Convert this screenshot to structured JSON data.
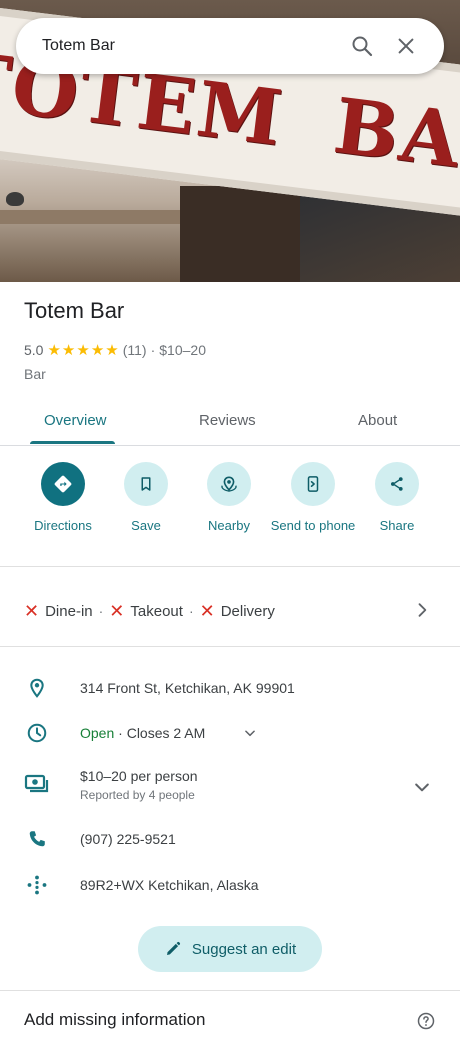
{
  "search": {
    "value": "Totem Bar"
  },
  "hero": {
    "sign_left": "TOTEM",
    "sign_right": "BAR"
  },
  "place": {
    "name": "Totem Bar",
    "rating": "5.0",
    "stars": 5,
    "reviews": "(11)",
    "dot": "·",
    "price": "$10–20",
    "category": "Bar"
  },
  "tabs": [
    {
      "label": "Overview",
      "active": true
    },
    {
      "label": "Reviews",
      "active": false
    },
    {
      "label": "About",
      "active": false
    }
  ],
  "actions": [
    {
      "label": "Directions",
      "icon": "directions-icon"
    },
    {
      "label": "Save",
      "icon": "bookmark-icon"
    },
    {
      "label": "Nearby",
      "icon": "nearby-icon"
    },
    {
      "label": "Send to phone",
      "icon": "send-to-phone-icon"
    },
    {
      "label": "Share",
      "icon": "share-icon"
    }
  ],
  "services": {
    "items": [
      "Dine-in",
      "Takeout",
      "Delivery"
    ],
    "separator": "·"
  },
  "info": {
    "address": "314 Front St, Ketchikan, AK 99901",
    "hours_open": "Open",
    "hours_sep": " · ",
    "hours_close": "Closes 2 AM",
    "price_per_person": "$10–20 per person",
    "price_reported": "Reported by 4 people",
    "phone": "(907) 225-9521",
    "plus_code": "89R2+WX Ketchikan, Alaska"
  },
  "suggest_edit": "Suggest an edit",
  "add_missing": "Add missing information",
  "colors": {
    "accent": "#1a7681",
    "primary_button": "#107180",
    "tonal_button": "#d1eef0",
    "star": "#fbbc04",
    "unavailable": "#d93025",
    "open": "#188038"
  }
}
